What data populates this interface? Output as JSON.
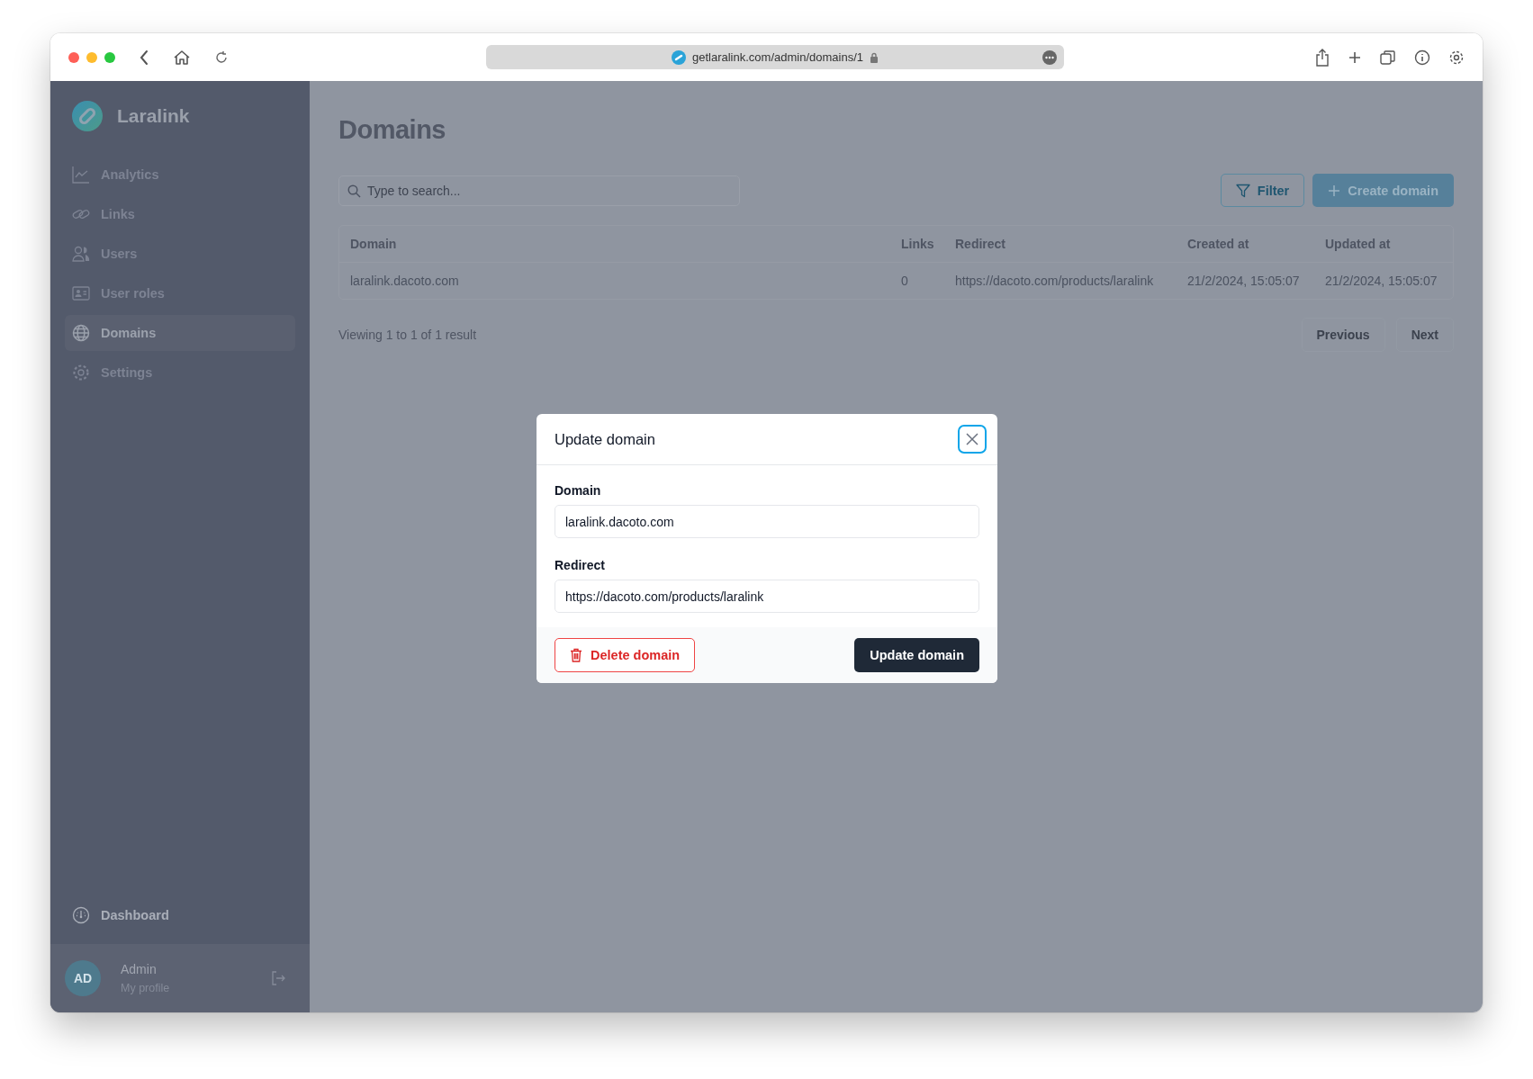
{
  "browser": {
    "url": "getlaralink.com/admin/domains/1"
  },
  "sidebar": {
    "brand": "Laralink",
    "items": [
      {
        "label": "Analytics",
        "selected": false
      },
      {
        "label": "Links",
        "selected": false
      },
      {
        "label": "Users",
        "selected": false
      },
      {
        "label": "User roles",
        "selected": false
      },
      {
        "label": "Domains",
        "selected": true
      },
      {
        "label": "Settings",
        "selected": false
      }
    ],
    "bottom_item": "Dashboard",
    "user": {
      "initials": "AD",
      "name": "Admin",
      "subtitle": "My profile"
    }
  },
  "page": {
    "title": "Domains",
    "search": {
      "placeholder": "Type to search..."
    },
    "filter_button": "Filter",
    "create_button": "Create domain",
    "table": {
      "columns": [
        "Domain",
        "Links",
        "Redirect",
        "Created at",
        "Updated at"
      ],
      "rows": [
        [
          "laralink.dacoto.com",
          "0",
          "https://dacoto.com/products/laralink",
          "21/2/2024, 15:05:07",
          "21/2/2024, 15:05:07"
        ]
      ]
    },
    "summary": "Viewing 1 to 1 of 1 result",
    "pagination": [
      {
        "label": "Previous",
        "disabled": true
      },
      {
        "label": "Next",
        "disabled": true
      }
    ]
  },
  "modal": {
    "title": "Update domain",
    "fields": [
      {
        "label": "Domain",
        "value": "laralink.dacoto.com"
      },
      {
        "label": "Redirect",
        "value": "https://dacoto.com/products/laralink"
      }
    ],
    "delete_button": "Delete domain",
    "submit_button": "Update domain"
  }
}
